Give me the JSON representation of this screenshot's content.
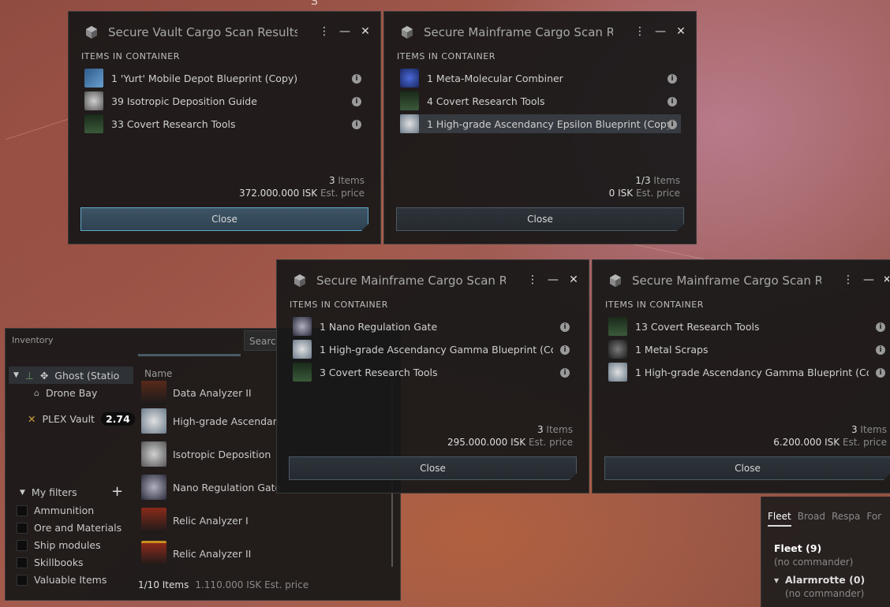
{
  "windows": [
    {
      "title": "Secure Vault Cargo Scan Results",
      "section": "ITEMS IN CONTAINER",
      "items": [
        "1 'Yurt' Mobile Depot Blueprint (Copy)",
        "39 Isotropic Deposition Guide",
        "33 Covert Research Tools"
      ],
      "count_value": "3",
      "count_label": "Items",
      "price_value": "372.000.000 ISK",
      "price_label": "Est. price",
      "close_label": "Close"
    },
    {
      "title": "Secure Mainframe Cargo Scan R",
      "section": "ITEMS IN CONTAINER",
      "items": [
        "1 Meta-Molecular Combiner",
        "4 Covert Research Tools",
        "1 High-grade Ascendancy Epsilon Blueprint (Copy"
      ],
      "count_value": "1/3",
      "count_label": "Items",
      "price_value": "0 ISK",
      "price_label": "Est. price",
      "close_label": "Close"
    },
    {
      "title": "Secure Mainframe Cargo Scan R",
      "section": "ITEMS IN CONTAINER",
      "items": [
        "1 Nano Regulation Gate",
        "1 High-grade Ascendancy Gamma Blueprint (Cop",
        "3 Covert Research Tools"
      ],
      "count_value": "3",
      "count_label": "Items",
      "price_value": "295.000.000 ISK",
      "price_label": "Est. price",
      "close_label": "Close"
    },
    {
      "title": "Secure Mainframe Cargo Scan R",
      "section": "ITEMS IN CONTAINER",
      "items": [
        "13 Covert Research Tools",
        "1 Metal Scraps",
        "1 High-grade Ascendancy Gamma Blueprint (Cop"
      ],
      "count_value": "3",
      "count_label": "Items",
      "price_value": "6.200.000 ISK",
      "price_label": "Est. price",
      "close_label": "Close"
    }
  ],
  "inventory": {
    "title": "Inventory",
    "search_placeholder": "Searc",
    "tree": {
      "ship": "Ghost (Statio",
      "drone_bay": "Drone Bay",
      "plex_vault": "PLEX Vault",
      "plex_amount": "2.74"
    },
    "column_name": "Name",
    "items": [
      "Data Analyzer II",
      "High-grade Ascendan",
      "Isotropic Deposition",
      "Nano Regulation Gate",
      "Relic Analyzer I",
      "Relic Analyzer II"
    ],
    "filters_title": "My filters",
    "filters": [
      "Ammunition",
      "Ore and Materials",
      "Ship modules",
      "Skillbooks",
      "Valuable Items"
    ],
    "footer_count": "1/10 Items",
    "footer_price": "1.110.000 ISK Est. price"
  },
  "fleet": {
    "tabs": [
      "Fleet",
      "Broad",
      "Respa",
      "For"
    ],
    "fleet_name": "Fleet (9)",
    "fleet_sub": "(no commander)",
    "squad_name": "Alarmrotte (0)",
    "squad_sub": "(no commander)"
  },
  "background_marker": "S"
}
